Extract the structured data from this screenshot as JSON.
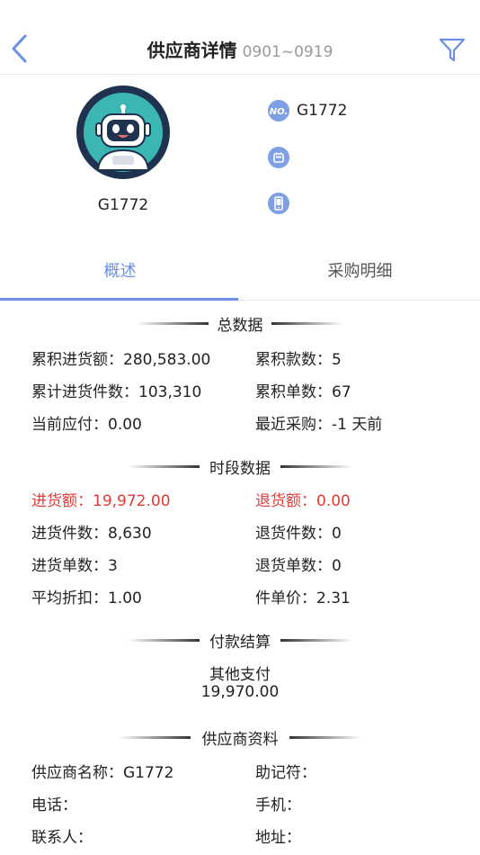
{
  "header": {
    "title": "供应商详情",
    "date_range": "0901~0919",
    "back_icon": "chevron-left-icon",
    "filter_icon": "filter-icon",
    "accent": "#6b8fe6"
  },
  "profile": {
    "name": "G1772",
    "no_value": "G1772",
    "phone_value": "",
    "mobile_value": ""
  },
  "tabs": [
    {
      "label": "概述",
      "active": true
    },
    {
      "label": "采购明细",
      "active": false
    }
  ],
  "summary": {
    "title": "总数据",
    "total_purchase_amount": {
      "label": "累积进货额：",
      "value": "280,583.00"
    },
    "total_payments": {
      "label": "累积款数：",
      "value": "5"
    },
    "total_purchase_qty": {
      "label": "累计进货件数：",
      "value": "103,310"
    },
    "total_orders": {
      "label": "累积单数：",
      "value": "67"
    },
    "current_payable": {
      "label": "当前应付：",
      "value": "0.00"
    },
    "last_purchase": {
      "label": "最近采购：",
      "value": "-1 天前"
    }
  },
  "period": {
    "title": "时段数据",
    "purchase_amount": {
      "label": "进货额：",
      "value": "19,972.00"
    },
    "return_amount": {
      "label": "退货额：",
      "value": "0.00"
    },
    "purchase_qty": {
      "label": "进货件数：",
      "value": "8,630"
    },
    "return_qty": {
      "label": "退货件数：",
      "value": "0"
    },
    "purchase_orders": {
      "label": "进货单数：",
      "value": "3"
    },
    "return_orders": {
      "label": "退货单数：",
      "value": "0"
    },
    "avg_discount": {
      "label": "平均折扣：",
      "value": "1.00"
    },
    "unit_price": {
      "label": "件单价：",
      "value": "2.31"
    }
  },
  "payment": {
    "title": "付款结算",
    "method": "其他支付",
    "amount": "19,970.00"
  },
  "supplier_info": {
    "title": "供应商资料",
    "name": {
      "label": "供应商名称：",
      "value": "G1772"
    },
    "mnemonic": {
      "label": "助记符：",
      "value": ""
    },
    "phone": {
      "label": "电话：",
      "value": ""
    },
    "mobile": {
      "label": "手机：",
      "value": ""
    },
    "contact": {
      "label": "联系人：",
      "value": ""
    },
    "address": {
      "label": "地址：",
      "value": ""
    }
  },
  "colors": {
    "red": "#e53935",
    "icon_bg": "#7f9fe4"
  }
}
